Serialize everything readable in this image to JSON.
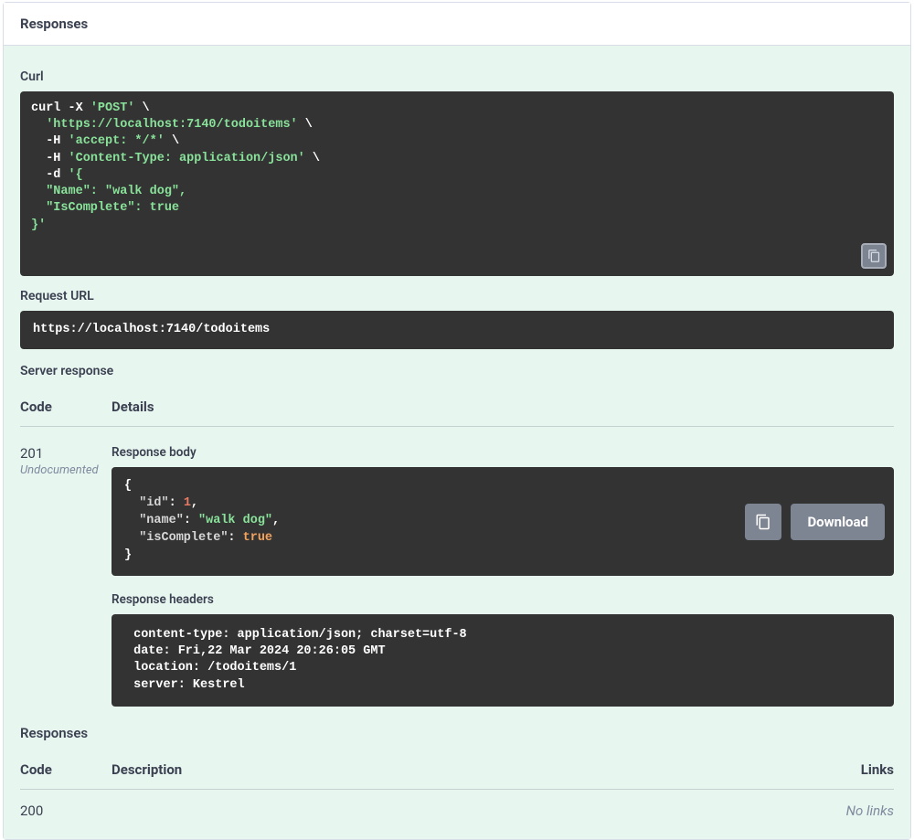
{
  "panel": {
    "title": "Responses"
  },
  "curl": {
    "label": "Curl",
    "prefix": "curl -X ",
    "method": "'POST'",
    "cont": " \\",
    "url_indent": "  ",
    "url": "'https://localhost:7140/todoitems'",
    "h_indent": "  -H ",
    "accept": "'accept: */*'",
    "ctype": "'Content-Type: application/json'",
    "d_indent": "  -d ",
    "d_open": "'{",
    "body_indent": "  ",
    "name_pair": "\"Name\": \"walk dog\",",
    "isc_pair": "\"IsComplete\": true",
    "close": "}'"
  },
  "requestUrl": {
    "label": "Request URL",
    "value": "https://localhost:7140/todoitems"
  },
  "serverResponse": {
    "label": "Server response",
    "codeHeader": "Code",
    "detailsHeader": "Details",
    "code": "201",
    "undocumented": "Undocumented",
    "responseBodyLabel": "Response body",
    "body": {
      "open": "{",
      "id_k": "\"id\"",
      "id_v": "1",
      "name_k": "\"name\"",
      "name_v": "\"walk dog\"",
      "isc_k": "\"isComplete\"",
      "isc_v": "true",
      "close": "}"
    },
    "downloadLabel": "Download",
    "responseHeadersLabel": "Response headers",
    "headers": " content-type: application/json; charset=utf-8 \n date: Fri,22 Mar 2024 20:26:05 GMT \n location: /todoitems/1 \n server: Kestrel "
  },
  "responses2": {
    "label": "Responses",
    "codeHeader": "Code",
    "descriptionHeader": "Description",
    "linksHeader": "Links",
    "code": "200",
    "noLinks": "No links"
  }
}
